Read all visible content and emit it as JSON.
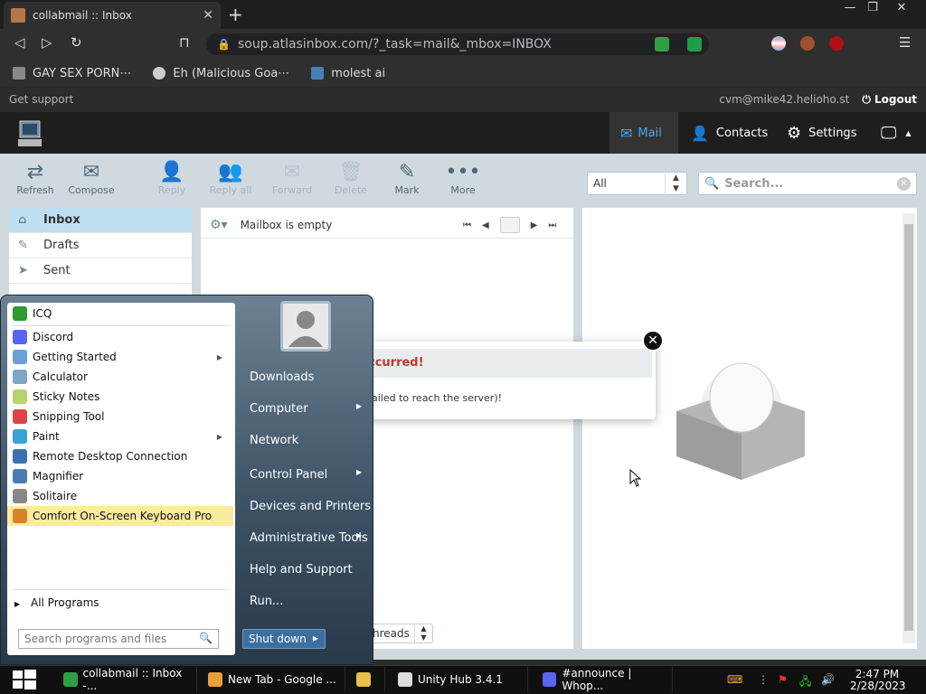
{
  "browser": {
    "tab_title": "collabmail :: Inbox",
    "tab_close": "✕",
    "new_tab": "+",
    "url": "soup.atlasinbox.com/?_task=mail&_mbox=INBOX",
    "window_buttons": [
      "—",
      "❐",
      "✕"
    ],
    "nav": {
      "back": "◁",
      "forward": "▷",
      "reload": "↻",
      "bookmark": "⊓"
    }
  },
  "bookmarks": [
    {
      "label": "GAY SEX PORN⋯",
      "icon": "bookmark-icon",
      "color": "#888888"
    },
    {
      "label": "Eh (Malicious Goa⋯",
      "icon": "globe-icon",
      "color": "#cccccc"
    },
    {
      "label": "molest ai",
      "icon": "app-icon",
      "color": "#4a7fb5"
    }
  ],
  "roundcube": {
    "get_support": "Get support",
    "user_email": "cvm@mike42.helioho.st",
    "logout": "Logout",
    "nav": [
      {
        "label": "Mail",
        "icon": "mail-icon",
        "selected": true
      },
      {
        "label": "Contacts",
        "icon": "contacts-icon",
        "selected": false
      },
      {
        "label": "Settings",
        "icon": "settings-icon",
        "selected": false
      }
    ],
    "toolbar": [
      {
        "label": "Refresh",
        "icon": "refresh-icon",
        "glyph": "⇄",
        "enabled": true
      },
      {
        "label": "Compose",
        "icon": "compose-icon",
        "glyph": "✉",
        "enabled": true
      },
      {
        "label": "Reply",
        "icon": "reply-icon",
        "glyph": "👤",
        "enabled": false
      },
      {
        "label": "Reply all",
        "icon": "reply-all-icon",
        "glyph": "👥",
        "enabled": false
      },
      {
        "label": "Forward",
        "icon": "forward-icon",
        "glyph": "✉",
        "enabled": false
      },
      {
        "label": "Delete",
        "icon": "delete-icon",
        "glyph": "🗑",
        "enabled": false
      },
      {
        "label": "Mark",
        "icon": "mark-icon",
        "glyph": "✎",
        "enabled": true
      },
      {
        "label": "More",
        "icon": "more-icon",
        "glyph": "•••",
        "enabled": true
      }
    ],
    "filter_value": "All",
    "search_placeholder": "Search...",
    "folders": [
      {
        "label": "Inbox",
        "icon": "inbox-icon",
        "glyph": "⌂",
        "selected": true
      },
      {
        "label": "Drafts",
        "icon": "drafts-icon",
        "glyph": "✎",
        "selected": false
      },
      {
        "label": "Sent",
        "icon": "sent-icon",
        "glyph": "➤",
        "selected": false
      }
    ],
    "mailbox_status": "Mailbox is empty",
    "threads_select": "hreads",
    "error": {
      "title": "ccurred!",
      "message": "ailed to reach the server)!"
    }
  },
  "start_menu": {
    "programs": [
      {
        "label": "ICQ",
        "icon": "icq-icon",
        "color": "#2e9b2e",
        "submenu": false,
        "highlight": false
      },
      {
        "label": "Discord",
        "icon": "discord-icon",
        "color": "#5865f2",
        "submenu": false,
        "highlight": false
      },
      {
        "label": "Getting Started",
        "icon": "getting-started-icon",
        "color": "#6aa0d8",
        "submenu": true,
        "highlight": false
      },
      {
        "label": "Calculator",
        "icon": "calculator-icon",
        "color": "#7da7c7",
        "submenu": false,
        "highlight": false
      },
      {
        "label": "Sticky Notes",
        "icon": "sticky-notes-icon",
        "color": "#b7d36b",
        "submenu": false,
        "highlight": false
      },
      {
        "label": "Snipping Tool",
        "icon": "snipping-tool-icon",
        "color": "#d44",
        "submenu": false,
        "highlight": false
      },
      {
        "label": "Paint",
        "icon": "paint-icon",
        "color": "#3aa0d8",
        "submenu": true,
        "highlight": false
      },
      {
        "label": "Remote Desktop Connection",
        "icon": "remote-desktop-icon",
        "color": "#3b6fb0",
        "submenu": false,
        "highlight": false
      },
      {
        "label": "Magnifier",
        "icon": "magnifier-icon",
        "color": "#4b7bb0",
        "submenu": false,
        "highlight": false
      },
      {
        "label": "Solitaire",
        "icon": "solitaire-icon",
        "color": "#888",
        "submenu": false,
        "highlight": false
      },
      {
        "label": "Comfort On-Screen Keyboard Pro",
        "icon": "keyboard-icon",
        "color": "#d8822a",
        "submenu": false,
        "highlight": true
      }
    ],
    "all_programs": "All Programs",
    "search_placeholder": "Search programs and files",
    "links": [
      {
        "label": "Downloads",
        "submenu": false
      },
      {
        "label": "Computer",
        "submenu": true
      },
      {
        "label": "Network",
        "submenu": false
      },
      {
        "label": "Control Panel",
        "submenu": true
      },
      {
        "label": "Devices and Printers",
        "submenu": false
      },
      {
        "label": "Administrative Tools",
        "submenu": true
      },
      {
        "label": "Help and Support",
        "submenu": false
      },
      {
        "label": "Run...",
        "submenu": false
      }
    ],
    "shutdown": "Shut down"
  },
  "taskbar": {
    "items": [
      {
        "label": "collabmail :: Inbox -...",
        "icon": "roundcube-icon",
        "color": "#2ea043"
      },
      {
        "label": "New Tab - Google ...",
        "icon": "chrome-icon",
        "color": "#e8a13a"
      },
      {
        "label": "",
        "icon": "folder-icon",
        "color": "#e8c04a"
      },
      {
        "label": "Unity Hub 3.4.1",
        "icon": "unity-icon",
        "color": "#dddddd"
      },
      {
        "label": "#announce | Whop...",
        "icon": "discord-icon",
        "color": "#5865f2"
      }
    ],
    "time": "2:47 PM",
    "date": "2/28/2023"
  }
}
